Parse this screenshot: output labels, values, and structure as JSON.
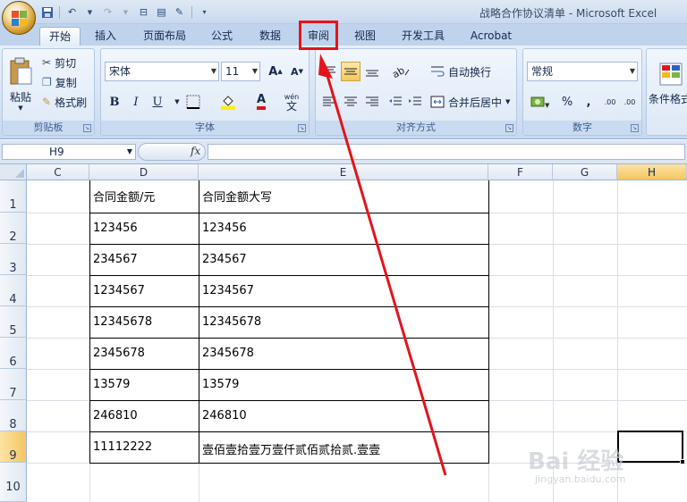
{
  "window": {
    "title": "战略合作协议清单 - Microsoft Excel"
  },
  "tabs": [
    "开始",
    "插入",
    "页面布局",
    "公式",
    "数据",
    "审阅",
    "视图",
    "开发工具",
    "Acrobat"
  ],
  "clipboard": {
    "paste": "粘贴",
    "cut": "剪切",
    "copy": "复制",
    "format_painter": "格式刷",
    "label": "剪贴板"
  },
  "font": {
    "name": "宋体",
    "size": "11",
    "label": "字体",
    "bold": "B",
    "italic": "I",
    "underline": "U",
    "grow": "A",
    "shrink": "A",
    "color_glyph": "A",
    "phonetic": "wén"
  },
  "alignment": {
    "wrap": "自动换行",
    "merge": "合并后居中",
    "label": "对齐方式"
  },
  "number": {
    "format": "常规",
    "label": "数字",
    "percent": "%",
    "comma": ",",
    "inc": ".00",
    "dec": ".00"
  },
  "styles": {
    "conditional": "条件格式"
  },
  "formula_bar": {
    "name_box": "H9",
    "fx": "fx",
    "content": ""
  },
  "columns": [
    "C",
    "D",
    "E",
    "F",
    "G",
    "H"
  ],
  "rows": [
    "1",
    "2",
    "3",
    "4",
    "5",
    "6",
    "7",
    "8",
    "9",
    "10"
  ],
  "table": {
    "headers": [
      "合同金额/元",
      "合同金额大写"
    ],
    "rows": [
      [
        "123456",
        "123456"
      ],
      [
        "234567",
        "234567"
      ],
      [
        "1234567",
        "1234567"
      ],
      [
        "12345678",
        "12345678"
      ],
      [
        "2345678",
        "2345678"
      ],
      [
        "13579",
        "13579"
      ],
      [
        "246810",
        "246810"
      ],
      [
        "11112222",
        "壹佰壹拾壹万壹仟贰佰贰拾贰.壹壹"
      ]
    ]
  },
  "watermark": {
    "main": "Bai 经验",
    "sub": "jingyan.baidu.com"
  },
  "colors": {
    "highlight": "#e3141c",
    "arrow": "#e3141c",
    "ribbon": "#dbe7f6"
  }
}
